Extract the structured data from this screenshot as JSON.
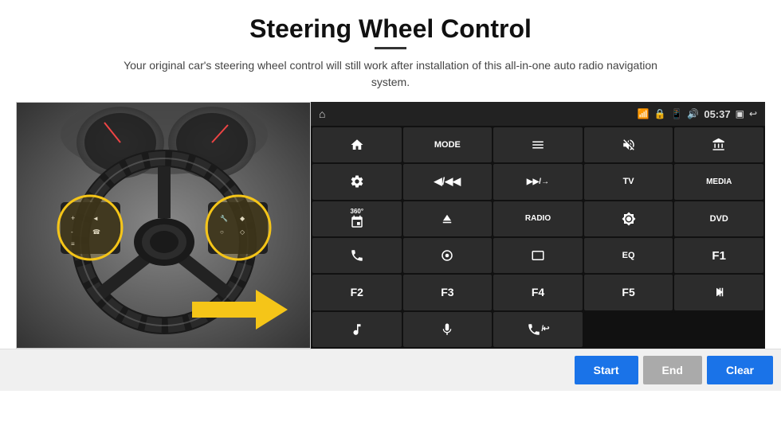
{
  "page": {
    "title": "Steering Wheel Control",
    "subtitle": "Your original car's steering wheel control will still work after installation of this all-in-one auto radio navigation system."
  },
  "statusbar": {
    "time": "05:37",
    "icons": [
      "wifi",
      "lock",
      "sim",
      "bluetooth",
      "back",
      "home"
    ]
  },
  "grid_cells": [
    {
      "id": "home",
      "label": "",
      "icon": "home",
      "col": 1,
      "row": 1
    },
    {
      "id": "mode",
      "label": "MODE",
      "icon": "",
      "col": 2,
      "row": 1
    },
    {
      "id": "list",
      "label": "",
      "icon": "menu",
      "col": 3,
      "row": 1
    },
    {
      "id": "vol-mute",
      "label": "",
      "icon": "vol-mute",
      "col": 4,
      "row": 1
    },
    {
      "id": "apps",
      "label": "",
      "icon": "apps",
      "col": 5,
      "row": 1
    },
    {
      "id": "settings",
      "label": "",
      "icon": "settings",
      "col": 1,
      "row": 2
    },
    {
      "id": "prev",
      "label": "◀/◀◀",
      "icon": "",
      "col": 2,
      "row": 2
    },
    {
      "id": "next",
      "label": "▶▶/→",
      "icon": "",
      "col": 3,
      "row": 2
    },
    {
      "id": "tv",
      "label": "TV",
      "icon": "",
      "col": 4,
      "row": 2
    },
    {
      "id": "media",
      "label": "MEDIA",
      "icon": "",
      "col": 5,
      "row": 2
    },
    {
      "id": "cam360",
      "label": "360°",
      "icon": "",
      "col": 1,
      "row": 3
    },
    {
      "id": "eject",
      "label": "",
      "icon": "eject",
      "col": 2,
      "row": 3
    },
    {
      "id": "radio",
      "label": "RADIO",
      "icon": "",
      "col": 3,
      "row": 3
    },
    {
      "id": "brightness",
      "label": "",
      "icon": "bright",
      "col": 4,
      "row": 3
    },
    {
      "id": "dvd",
      "label": "DVD",
      "icon": "",
      "col": 5,
      "row": 3
    },
    {
      "id": "phone",
      "label": "",
      "icon": "phone",
      "col": 1,
      "row": 4
    },
    {
      "id": "swipe",
      "label": "",
      "icon": "swipe",
      "col": 2,
      "row": 4
    },
    {
      "id": "window",
      "label": "",
      "icon": "window",
      "col": 3,
      "row": 4
    },
    {
      "id": "eq",
      "label": "EQ",
      "icon": "",
      "col": 4,
      "row": 4
    },
    {
      "id": "f1",
      "label": "F1",
      "icon": "",
      "col": 5,
      "row": 4
    },
    {
      "id": "f2",
      "label": "F2",
      "icon": "",
      "col": 1,
      "row": 5
    },
    {
      "id": "f3",
      "label": "F3",
      "icon": "",
      "col": 2,
      "row": 5
    },
    {
      "id": "f4",
      "label": "F4",
      "icon": "",
      "col": 3,
      "row": 5
    },
    {
      "id": "f5",
      "label": "F5",
      "icon": "",
      "col": 4,
      "row": 5
    },
    {
      "id": "playpause",
      "label": "▶⏸",
      "icon": "",
      "col": 5,
      "row": 5
    },
    {
      "id": "music",
      "label": "",
      "icon": "music",
      "col": 1,
      "row": 6
    },
    {
      "id": "mic",
      "label": "",
      "icon": "mic",
      "col": 2,
      "row": 6
    },
    {
      "id": "handsfree",
      "label": "",
      "icon": "handsfree",
      "col": 3,
      "row": 6
    }
  ],
  "bottom_buttons": {
    "start": "Start",
    "end": "End",
    "clear": "Clear"
  },
  "colors": {
    "accent": "#1a73e8",
    "button_disabled": "#aaaaaa",
    "panel_bg": "#1a1a1a",
    "cell_bg": "#2c2c2c"
  }
}
